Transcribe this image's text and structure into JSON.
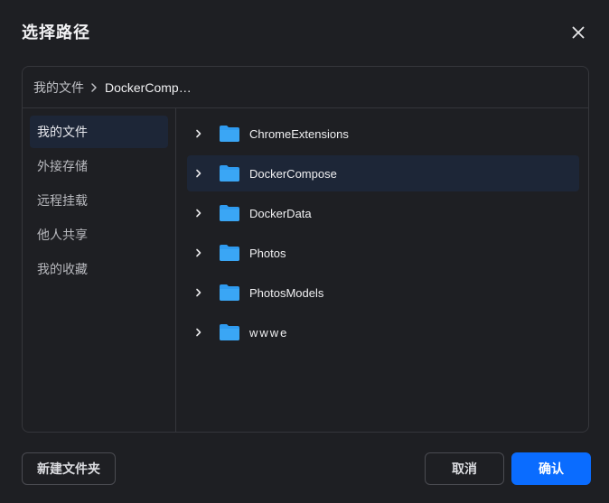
{
  "dialog": {
    "title": "选择路径",
    "close_icon": "close-icon"
  },
  "breadcrumb": {
    "root": "我的文件",
    "separator_icon": "chevron-right-icon",
    "current": "DockerComp…"
  },
  "sidebar": {
    "items": [
      {
        "label": "我的文件",
        "active": true
      },
      {
        "label": "外接存储",
        "active": false
      },
      {
        "label": "远程挂载",
        "active": false
      },
      {
        "label": "他人共享",
        "active": false
      },
      {
        "label": "我的收藏",
        "active": false
      }
    ]
  },
  "files": {
    "items": [
      {
        "name": "ChromeExtensions",
        "icon": "folder-icon",
        "selected": false
      },
      {
        "name": "DockerCompose",
        "icon": "folder-icon",
        "selected": true
      },
      {
        "name": "DockerData",
        "icon": "folder-icon",
        "selected": false
      },
      {
        "name": "Photos",
        "icon": "folder-icon",
        "selected": false
      },
      {
        "name": "PhotosModels",
        "icon": "folder-icon",
        "selected": false
      },
      {
        "name": "wwwe",
        "icon": "folder-icon",
        "selected": false
      }
    ]
  },
  "footer": {
    "new_folder_label": "新建文件夹",
    "cancel_label": "取消",
    "confirm_label": "确认"
  },
  "colors": {
    "background": "#1e1f23",
    "accent": "#0a6cff",
    "selected_row": "#1d2637",
    "folder": "#2f9bf0"
  }
}
